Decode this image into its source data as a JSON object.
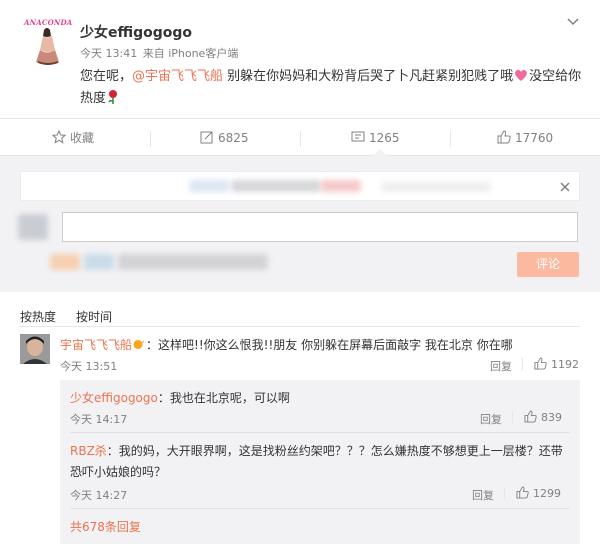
{
  "post": {
    "avatar_text": "ANACONDA",
    "author": "少女effigogogo",
    "time": "今天 13:41",
    "source": "来自 iPhone客户端",
    "text_before": "您在呢，",
    "mention": "@宇宙飞飞飞船",
    "text_mid": " 别躲在你妈妈和大粉背后哭了卜凡赶紧别犯贱了哦",
    "text_after": "没空给你热度"
  },
  "actions": {
    "favorite": "收藏",
    "forward": "6825",
    "comment": "1265",
    "like": "17760"
  },
  "composer": {
    "submit": "评论"
  },
  "sort": {
    "hot": "按热度",
    "time": "按时间"
  },
  "comments": [
    {
      "name": "宇宙飞飞飞船",
      "text": "：这样吧!!你这么恨我!!朋友 你别躲在屏幕后面敲字 我在北京 你在哪",
      "time": "今天 13:51",
      "reply": "回复",
      "likes": "1192"
    }
  ],
  "replies": [
    {
      "name": "少女effigogogo",
      "text": "：我也在北京呢，可以啊",
      "time": "今天 14:17",
      "reply": "回复",
      "likes": "839"
    },
    {
      "name": "RBZ杀",
      "text_line1": "：我的妈，大开眼界啊，这是找粉丝约架吧？？？怎么嫌热度不够想更上一层楼？还带",
      "text_line2": "恐吓小姑娘的吗？",
      "time": "今天 14:27",
      "reply": "回复",
      "likes": "1299"
    }
  ],
  "more_replies": "共678条回复"
}
